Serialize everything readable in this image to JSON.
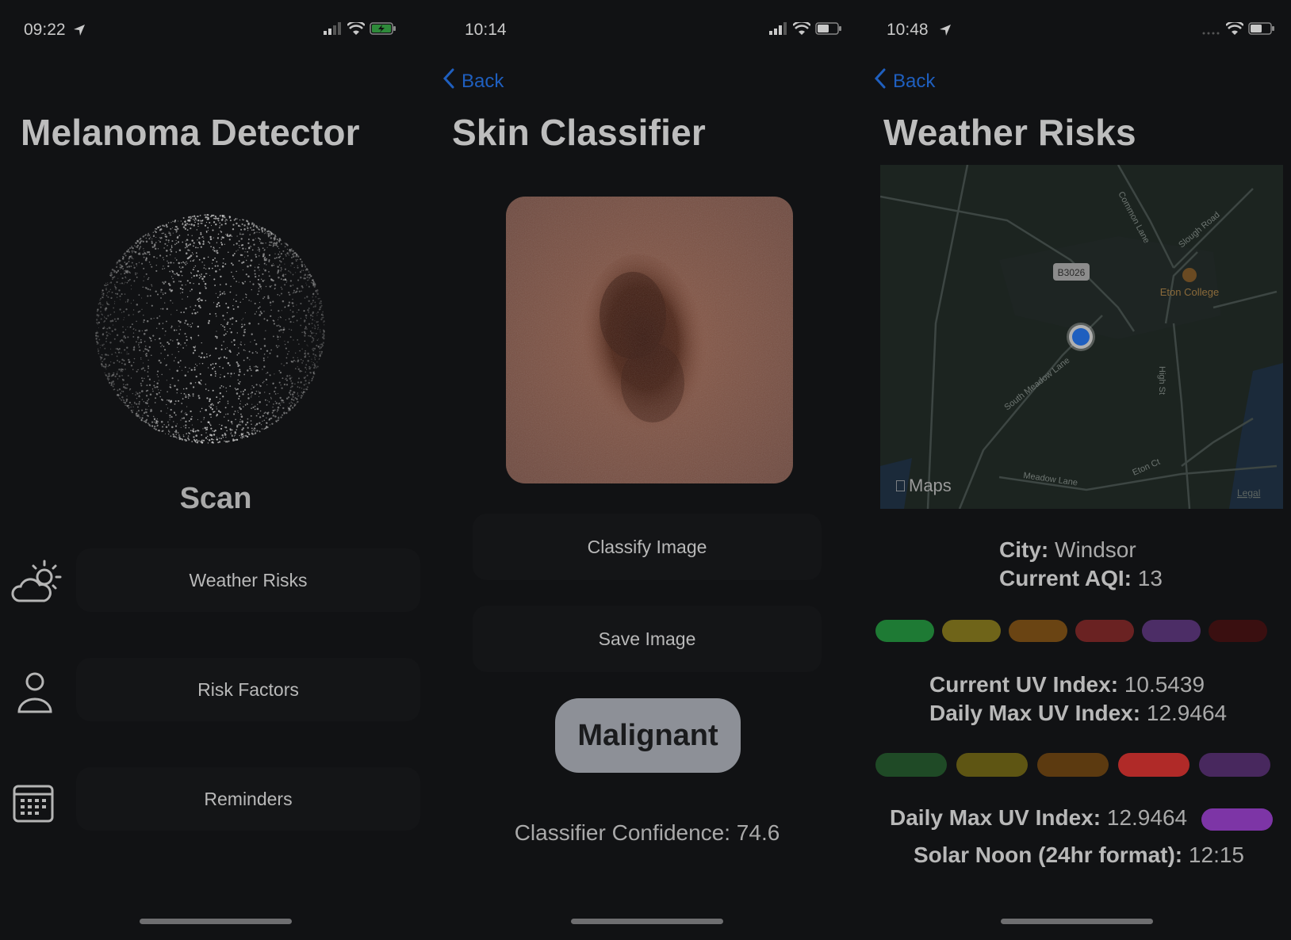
{
  "screen1": {
    "time": "09:22",
    "title": "Melanoma Detector",
    "scan_label": "Scan",
    "menu": [
      {
        "label": "Weather Risks",
        "icon": "cloud-sun-icon"
      },
      {
        "label": "Risk Factors",
        "icon": "person-icon"
      },
      {
        "label": "Reminders",
        "icon": "calendar-icon"
      }
    ]
  },
  "screen2": {
    "time": "10:14",
    "back_label": "Back",
    "title": "Skin Classifier",
    "classify_label": "Classify Image",
    "save_label": "Save Image",
    "result": "Malignant",
    "confidence_text": "Classifier Confidence: 74.6"
  },
  "screen3": {
    "time": "10:48",
    "back_label": "Back",
    "title": "Weather Risks",
    "map": {
      "road_badge": "B3026",
      "poi": "Eton College",
      "roads": [
        "Common Lane",
        "Slough Road",
        "South Meadow Lane",
        "High St",
        "Meadow Lane",
        "Eton Ct"
      ],
      "maps_label": "Maps",
      "legal_label": "Legal"
    },
    "city_label": "City:",
    "city_value": "Windsor",
    "aqi_label": "Current AQI:",
    "aqi_value": "13",
    "uv_current_label": "Current UV Index:",
    "uv_current_value": "10.5439",
    "uv_max_label": "Daily Max UV Index:",
    "uv_max_value": "12.9464",
    "uv_max_label_2": "Daily Max UV Index:",
    "uv_max_value_2": "12.9464",
    "solar_noon_label": "Solar Noon (24hr format):",
    "solar_noon_value": "12:15",
    "aqi_scale_colors": [
      "#1e7a34",
      "#6f6419",
      "#6a4413",
      "#6a2222",
      "#4c2d66",
      "#3a0f10"
    ],
    "uv_scale_colors": [
      "#1f4a26",
      "#5e5513",
      "#5c3a10",
      "#b02a28",
      "#48285e"
    ],
    "uv_max_indicator_color": "#7d35a6"
  }
}
